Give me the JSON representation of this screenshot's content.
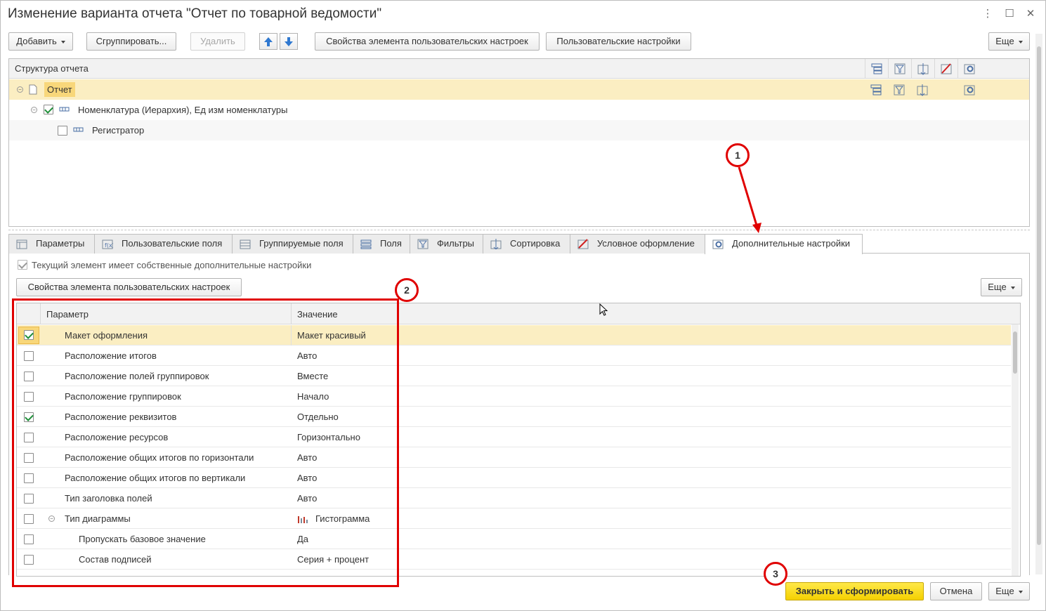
{
  "window": {
    "title": "Изменение варианта отчета \"Отчет по товарной ведомости\"",
    "menu_glyph": "⋮",
    "maximize_glyph": "☐",
    "close_glyph": "✕"
  },
  "toolbar": {
    "add_label": "Добавить",
    "group_label": "Сгруппировать...",
    "delete_label": "Удалить",
    "item_props_label": "Свойства элемента пользовательских настроек",
    "user_settings_label": "Пользовательские настройки",
    "more_label": "Еще"
  },
  "tree": {
    "header": "Структура отчета",
    "rows": [
      {
        "label": "Отчет"
      },
      {
        "label": "Номенклатура (Иерархия), Ед изм номенклатуры"
      },
      {
        "label": "Регистратор"
      }
    ]
  },
  "tabs": [
    {
      "label": "Параметры",
      "icon": "parameters-icon"
    },
    {
      "label": "Пользовательские поля",
      "icon": "custom-fields-icon"
    },
    {
      "label": "Группируемые поля",
      "icon": "grouping-fields-icon"
    },
    {
      "label": "Поля",
      "icon": "fields-icon"
    },
    {
      "label": "Фильтры",
      "icon": "filter-icon"
    },
    {
      "label": "Сортировка",
      "icon": "sort-icon"
    },
    {
      "label": "Условное оформление",
      "icon": "conditional-format-icon"
    },
    {
      "label": "Дополнительные настройки",
      "icon": "extra-settings-icon"
    }
  ],
  "extra": {
    "own_settings_label": "Текущий элемент имеет собственные дополнительные настройки",
    "item_props_label": "Свойства элемента пользовательских настроек",
    "more_label": "Еще"
  },
  "grid": {
    "col_param": "Параметр",
    "col_value": "Значение",
    "rows": [
      {
        "param": "Макет оформления",
        "value": "Макет красивый"
      },
      {
        "param": "Расположение итогов",
        "value": "Авто"
      },
      {
        "param": "Расположение полей группировок",
        "value": "Вместе"
      },
      {
        "param": "Расположение группировок",
        "value": "Начало"
      },
      {
        "param": "Расположение реквизитов",
        "value": "Отдельно"
      },
      {
        "param": "Расположение ресурсов",
        "value": "Горизонтально"
      },
      {
        "param": "Расположение общих итогов по горизонтали",
        "value": "Авто"
      },
      {
        "param": "Расположение общих итогов по вертикали",
        "value": "Авто"
      },
      {
        "param": "Тип заголовка полей",
        "value": "Авто"
      },
      {
        "param": "Тип диаграммы",
        "value": "Гистограмма"
      },
      {
        "param": "Пропускать базовое значение",
        "value": "Да"
      },
      {
        "param": "Состав подписей",
        "value": "Серия + процент"
      }
    ]
  },
  "footer": {
    "close_generate_label": "Закрыть и сформировать",
    "cancel_label": "Отмена",
    "more_label": "Еще"
  },
  "annotations": {
    "n1": "1",
    "n2": "2",
    "n3": "3",
    "color": "#e00000"
  },
  "colors": {
    "selection": "#fbeec2",
    "accent_button": "#f4d000",
    "check": "#1f8f3a"
  }
}
